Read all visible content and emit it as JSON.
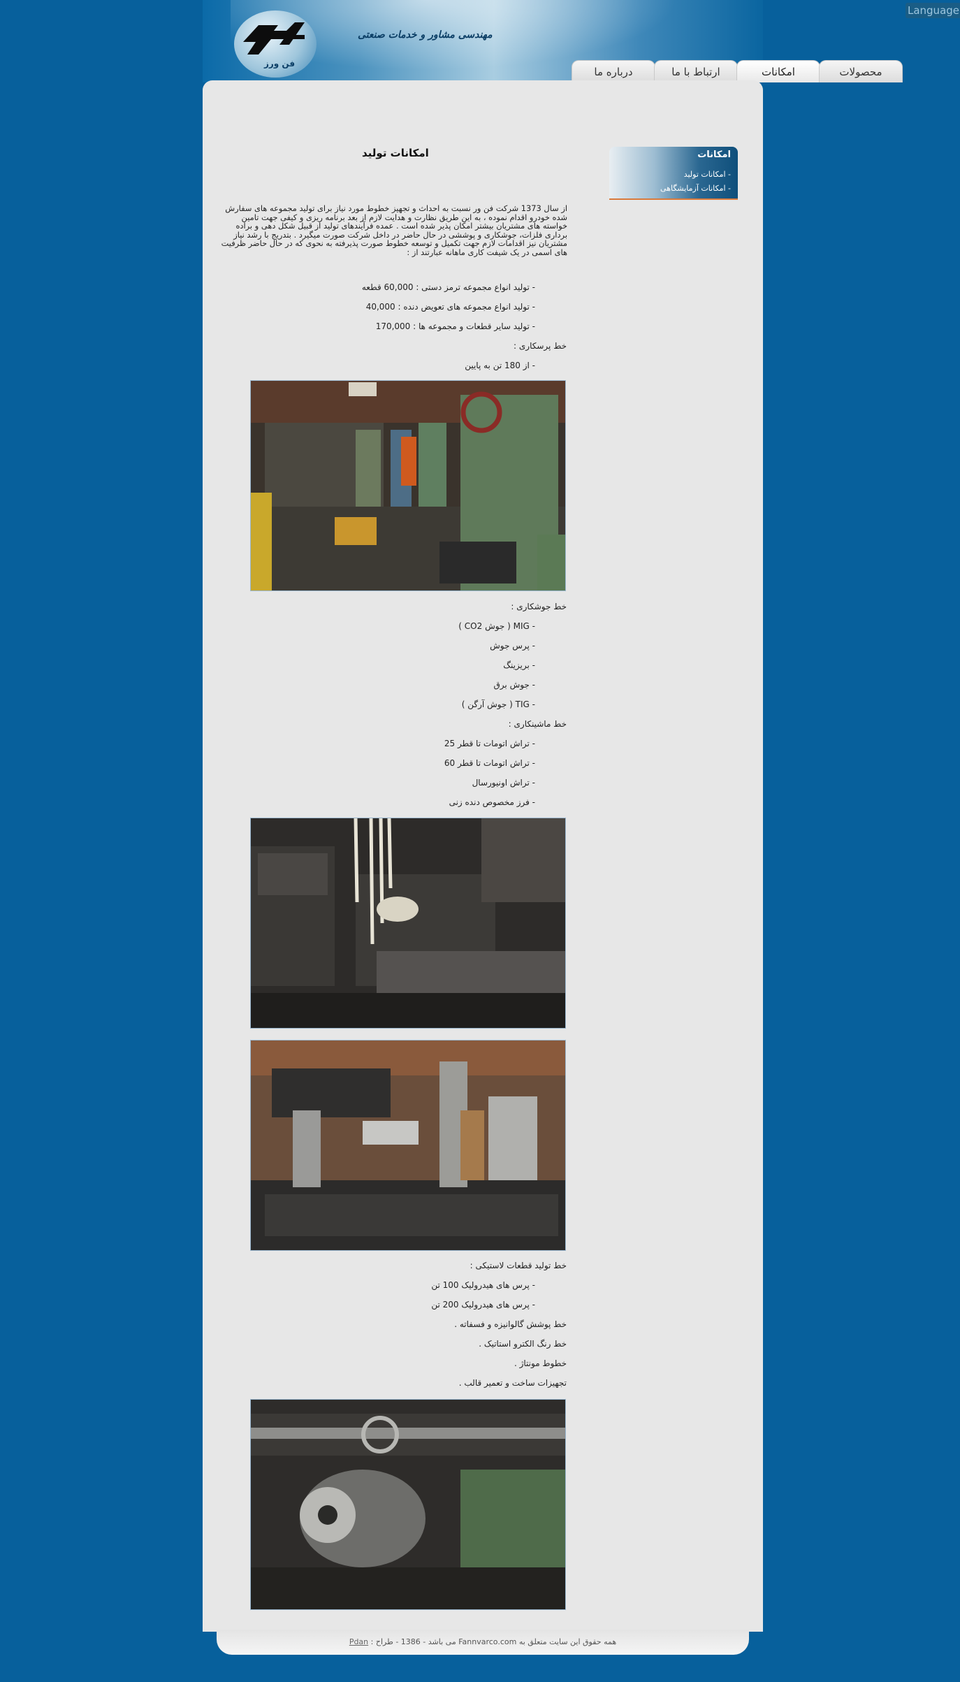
{
  "header": {
    "company_name": "مهندسی مشاور و خدمات صنعتی",
    "logo_subtext": "فن ورز",
    "language_button": "Language"
  },
  "nav": {
    "tabs": [
      {
        "label": "محصولات",
        "active": false
      },
      {
        "label": "امکانات",
        "active": true
      },
      {
        "label": "ارتباط با ما",
        "active": false
      },
      {
        "label": "درباره ما",
        "active": false
      }
    ]
  },
  "sidebar": {
    "title": "امکانات",
    "items": [
      "- امکانات تولید",
      "- امکانات آزمایشگاهی"
    ]
  },
  "main": {
    "title": "امکانات تولید",
    "intro": "از سال 1373 شرکت فن ور نسبت به احداث و تجهیز خطوط مورد نیاز برای تولید مجموعه های سفارش شده خودرو اقدام نموده ، به این طریق نظارت و هدایت لازم از بعد برنامه ریزی و کیفی جهت تامین خواسته های مشتریان بیشتر امکان پذیر شده است . عمده فرآیندهای تولید از قبیل شکل دهی و براده برداری فلزات، جوشکاری و پوششی در حال حاضر در داخل شرکت صورت میگیرد . بتدریج با رشد نیاز مشتریان نیز اقدامات لازم جهت تکمیل و توسعه خطوط صورت پذیرفته به نحوی که در حال حاضر ظرفیت های اسمی در یک شیفت کاری ماهانه عبارتند از :",
    "lines": {
      "l1": "- تولید انواع مجموعه ترمز دستی : 60,000 قطعه",
      "l2": "- تولید انواع مجموعه های تعویض دنده : 40,000",
      "l3": "- تولید سایر قطعات و مجموعه ها : 170,000",
      "h_press": "خط پرسکاری :",
      "l4": "- از 180 تن به پایین",
      "h_weld": "خط جوشکاری :",
      "l5": "- MIG ( جوش CO2 )",
      "l6": "- پرس جوش",
      "l7": "- بریزینگ",
      "l8": "- جوش برق",
      "l9": "- TIG ( جوش آرگن )",
      "h_mach": "خط ماشینکاری :",
      "l10": "- تراش اتومات تا قطر 25",
      "l11": "- تراش اتومات تا قطر 60",
      "l12": "- تراش اونیورسال",
      "l13": "- فرز مخصوص دنده زنی",
      "h_rubber": "خط تولید قطعات لاستیکی :",
      "l14": "- پرس های هیدرولیک 100 تن",
      "l15": "- پرس های هیدرولیک 200 تن",
      "h_galv": "خط پوشش گالوانیزه و فسفاته .",
      "h_paint": "خط رنگ الکترو استاتیک .",
      "h_assy": "خطوط مونتاژ .",
      "h_mold": "تجهیزات ساخت و تعمیر قالب ."
    }
  },
  "footer": {
    "text": "همه حقوق این سایت متعلق به Fannvarco.com می باشد - 1386 - طراح :",
    "designer_link": "Pdan"
  }
}
